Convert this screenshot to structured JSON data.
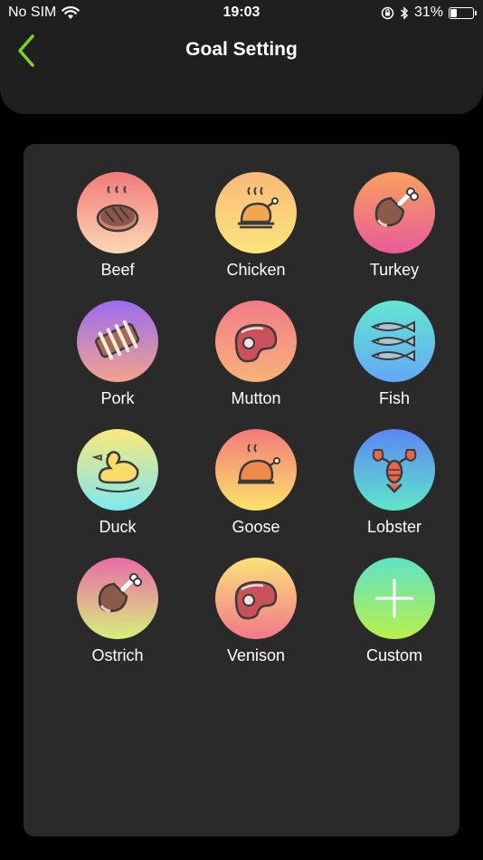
{
  "status": {
    "carrier": "No SIM",
    "time": "19:03",
    "battery_text": "31%",
    "battery_level": 0.31
  },
  "header": {
    "title": "Goal Setting"
  },
  "colors": {
    "accent": "#7ed321",
    "background": "#000000",
    "panel": "#2a2a2a",
    "header": "#1f1f1f"
  },
  "foods": [
    {
      "label": "Beef",
      "icon": "steak-icon",
      "gradient": [
        "#f27a7a",
        "#fbd8b4"
      ]
    },
    {
      "label": "Chicken",
      "icon": "roast-chicken-icon",
      "gradient": [
        "#f8b97a",
        "#fbe57c"
      ]
    },
    {
      "label": "Turkey",
      "icon": "drumstick-icon",
      "gradient": [
        "#f7a15e",
        "#e95b9a"
      ]
    },
    {
      "label": "Pork",
      "icon": "ribs-icon",
      "gradient": [
        "#9a6cf0",
        "#f3a38c"
      ]
    },
    {
      "label": "Mutton",
      "icon": "meat-cut-icon",
      "gradient": [
        "#f17c86",
        "#f8b27a"
      ]
    },
    {
      "label": "Fish",
      "icon": "fish-icon",
      "gradient": [
        "#64e6d2",
        "#63a8f5"
      ]
    },
    {
      "label": "Duck",
      "icon": "duck-icon",
      "gradient": [
        "#fbe87a",
        "#7ee8f0"
      ]
    },
    {
      "label": "Goose",
      "icon": "roast-goose-icon",
      "gradient": [
        "#f27a7a",
        "#fbe36c"
      ]
    },
    {
      "label": "Lobster",
      "icon": "lobster-icon",
      "gradient": [
        "#5c86f5",
        "#5ee6c8"
      ]
    },
    {
      "label": "Ostrich",
      "icon": "drumstick-icon",
      "gradient": [
        "#e96aa8",
        "#d7f07a"
      ]
    },
    {
      "label": "Venison",
      "icon": "meat-cut-icon",
      "gradient": [
        "#fbe27a",
        "#f2788a"
      ]
    },
    {
      "label": "Custom",
      "icon": "plus-icon",
      "gradient": [
        "#5ee3c6",
        "#b8f04a"
      ]
    }
  ]
}
